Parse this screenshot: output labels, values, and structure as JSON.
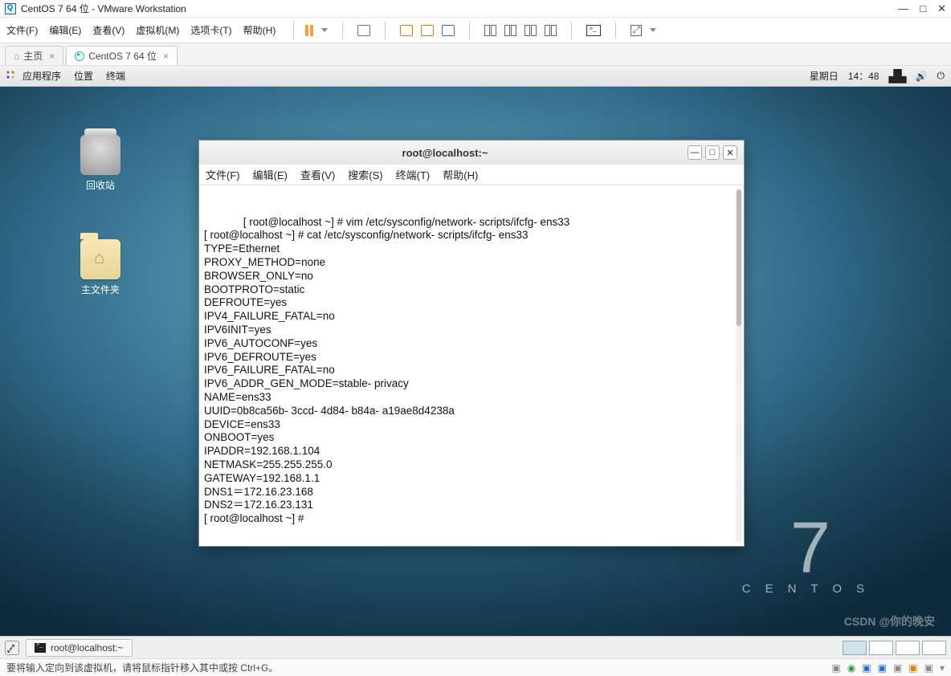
{
  "window": {
    "title": "CentOS 7 64 位 - VMware Workstation",
    "controls": {
      "min": "—",
      "max": "□",
      "close": "✕"
    }
  },
  "menubar": [
    "文件(F)",
    "编辑(E)",
    "查看(V)",
    "虚拟机(M)",
    "选项卡(T)",
    "帮助(H)"
  ],
  "tabs": {
    "home": "主页",
    "active": "CentOS 7 64 位"
  },
  "gnome": {
    "applications": "应用程序",
    "places": "位置",
    "terminal_menu": "终端",
    "clock_day": "星期日",
    "clock_time": "14：48"
  },
  "desktop_icons": {
    "trash": "回收站",
    "home": "主文件夹"
  },
  "centos_branding": {
    "version": "7",
    "name": "CENTOS"
  },
  "terminal": {
    "title": "root@localhost:~",
    "menu": [
      "文件(F)",
      "编辑(E)",
      "查看(V)",
      "搜索(S)",
      "终端(T)",
      "帮助(H)"
    ],
    "window_controls": {
      "min": "—",
      "max": "□",
      "close": "✕"
    },
    "body": "[ root@localhost ~] # vim /etc/sysconfig/network- scripts/ifcfg- ens33\n[ root@localhost ~] # cat /etc/sysconfig/network- scripts/ifcfg- ens33\nTYPE=Ethernet\nPROXY_METHOD=none\nBROWSER_ONLY=no\nBOOTPROTO=static\nDEFROUTE=yes\nIPV4_FAILURE_FATAL=no\nIPV6INIT=yes\nIPV6_AUTOCONF=yes\nIPV6_DEFROUTE=yes\nIPV6_FAILURE_FATAL=no\nIPV6_ADDR_GEN_MODE=stable- privacy\nNAME=ens33\nUUID=0b8ca56b- 3ccd- 4d84- b84a- a19ae8d4238a\nDEVICE=ens33\nONBOOT=yes\nIPADDR=192.168.1.104\nNETMASK=255.255.255.0\nGATEWAY=192.168.1.1\nDNS1＝172.16.23.168\nDNS2＝172.16.23.131\n[ root@localhost ~] #"
  },
  "taskbar": {
    "terminal_task": "root@localhost:~"
  },
  "statusbar": {
    "text": "要将输入定向到该虚拟机，请将鼠标指针移入其中或按 Ctrl+G。"
  },
  "watermark": "CSDN @你的晚安"
}
